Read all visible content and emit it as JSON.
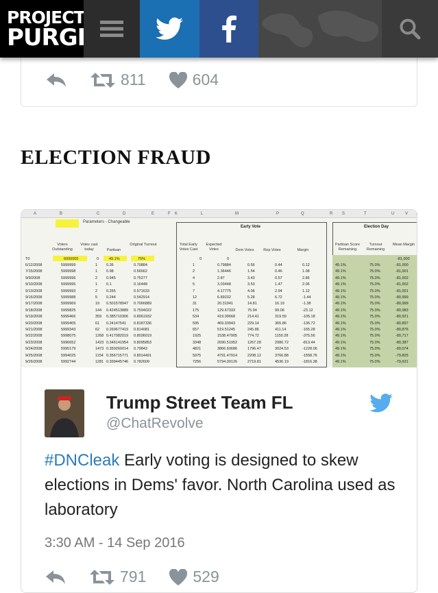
{
  "header": {
    "logo_line1": "PROJECT",
    "logo_line2": "PURGE"
  },
  "top_tweet_actions": {
    "retweets": "811",
    "likes": "604"
  },
  "headline": "ELECTION FRAUD",
  "spreadsheet": {
    "col_letters": [
      "A",
      "B",
      "C",
      "D",
      "E",
      "F",
      "K",
      "L",
      "M",
      "P",
      "Q",
      "R",
      "S",
      "T",
      "U",
      "V",
      "X"
    ],
    "params_label": "Parameters - Changeable",
    "early_vote_label": "Early Vote",
    "election_day_label": "Election Day",
    "headers": {
      "voters_outstanding": "Voters Outstanding",
      "votes_cast_today": "Votes cast today",
      "partisan": "Partisan",
      "original_turnout": "Original Turnout",
      "total_early_votes_cast": "Total Early Votes Cast",
      "expected_votes": "Expected Votes",
      "dem_votes": "Dem Votes",
      "rep_votes": "Rep Votes",
      "margin": "Margin",
      "partisan_score_remaining": "Partisan Score Remaining",
      "turnout_remaining": "Turnout Remaining",
      "mean_margin": "Mean Margin"
    },
    "t0": {
      "label": "T0",
      "voters": "6000000",
      "cast": "0",
      "partisan": "49.1%",
      "turnout": "75%",
      "total": "0",
      "expected": "0",
      "mean": "-81,000"
    },
    "rows": [
      [
        "6/12/2008",
        "5999999",
        "1",
        "0.36",
        "0.79884",
        "1",
        "0.79884",
        "0.56",
        "0.44",
        "0.12",
        "49.1%",
        "75.0%",
        "-81,000"
      ],
      [
        "7/15/2008",
        "5999998",
        "1",
        "0.98",
        "0.56562",
        "2",
        "1.36446",
        "1.54",
        "0.46",
        "1.08",
        "49.1%",
        "75.0%",
        "-81,001"
      ],
      [
        "9/9/2008",
        "5999996",
        "2",
        "0.945",
        "0.75277",
        "4",
        "2.87",
        "3.43",
        "0.57",
        "2.86",
        "49.1%",
        "75.0%",
        "-81,002"
      ],
      [
        "9/10/2008",
        "5999995",
        "1",
        "0.1",
        "0.16448",
        "5",
        "3.03448",
        "3.53",
        "1.47",
        "2.06",
        "49.1%",
        "75.0%",
        "-81,002"
      ],
      [
        "9/13/2008",
        "5999993",
        "2",
        "0.265",
        "0.571633",
        "7",
        "4.17775",
        "4.06",
        "2.94",
        "1.12",
        "49.1%",
        "75.0%",
        "-81,001"
      ],
      [
        "9/16/2008",
        "5999988",
        "5",
        "0.244",
        "0.542914",
        "12",
        "6.89232",
        "5.28",
        "6.72",
        "-1.44",
        "49.1%",
        "75.0%",
        "-80,999"
      ],
      [
        "9/17/2008",
        "5999969",
        "19",
        "0.501578947",
        "0.7066889",
        "31",
        "20.31941",
        "14.81",
        "16.19",
        "-1.38",
        "49.1%",
        "75.0%",
        "-80,999"
      ],
      [
        "9/18/2008",
        "5999825",
        "144",
        "0.424513889",
        "0.7594022",
        "175",
        "129.67333",
        "75.94",
        "99.06",
        "-23.12",
        "49.1%",
        "75.0%",
        "-80,983"
      ],
      [
        "9/19/2008",
        "5999466",
        "359",
        "0.385710306",
        "0.8061932",
        "534",
        "419.09668",
        "214.41",
        "319.59",
        "-105.18",
        "49.1%",
        "75.0%",
        "-80,921"
      ],
      [
        "9/20/2008",
        "5999405",
        "61",
        "0.24147541",
        "0.8187336",
        "595",
        "469.03943",
        "229.14",
        "365.86",
        "-136.72",
        "49.1%",
        "75.0%",
        "-80,897"
      ],
      [
        "9/21/2008",
        "5999343",
        "62",
        "0.269677419",
        "0.814081",
        "657",
        "519.51245",
        "245.86",
        "411.14",
        "-165.28",
        "49.1%",
        "75.0%",
        "-80,876"
      ],
      [
        "9/22/2008",
        "5998075",
        "1268",
        "0.417082019",
        "0.8036019",
        "1925",
        "1538.47905",
        "774.72",
        "1150.28",
        "-375.56",
        "49.1%",
        "75.0%",
        "-80,717"
      ],
      [
        "9/23/2008",
        "5996652",
        "1423",
        "0.346141954",
        "0.8095853",
        "3348",
        "2690.51952",
        "1267.28",
        "2080.72",
        "-813.44",
        "49.1%",
        "75.0%",
        "-80,387"
      ],
      [
        "9/24/2008",
        "5995179",
        "1473",
        "0.359260014",
        "0.79843",
        "4821",
        "3866.60686",
        "1796.47",
        "3024.53",
        "-1228.06",
        "49.1%",
        "75.0%",
        "-80,074"
      ],
      [
        "9/25/2008",
        "5994025",
        "1154",
        "0.356715771",
        "0.8014491",
        "5975",
        "4791.47914",
        "2208.12",
        "3766.88",
        "-1558.76",
        "49.1%",
        "75.0%",
        "-79,825"
      ],
      [
        "9/26/2008",
        "5992744",
        "1281",
        "0.399445746",
        "0.782609",
        "7256",
        "5794.00126",
        "2719.81",
        "4536.19",
        "-1816.38",
        "49.1%",
        "75.0%",
        "-79,631"
      ]
    ]
  },
  "tweet": {
    "name": "Trump Street Team FL",
    "handle": "@ChatRevolve",
    "hashtag": "#DNCleak",
    "text": " Early voting is designed to skew elections in Dems' favor. North Carolina used as laboratory",
    "timestamp": "3:30 AM - 14 Sep 2016",
    "retweets": "791",
    "likes": "529"
  },
  "colors": {
    "twitter_blue": "#1b6fb3",
    "facebook_blue": "#2d4f8e",
    "hashtag_blue": "#2b7bb9",
    "action_gray": "#8a9399"
  }
}
